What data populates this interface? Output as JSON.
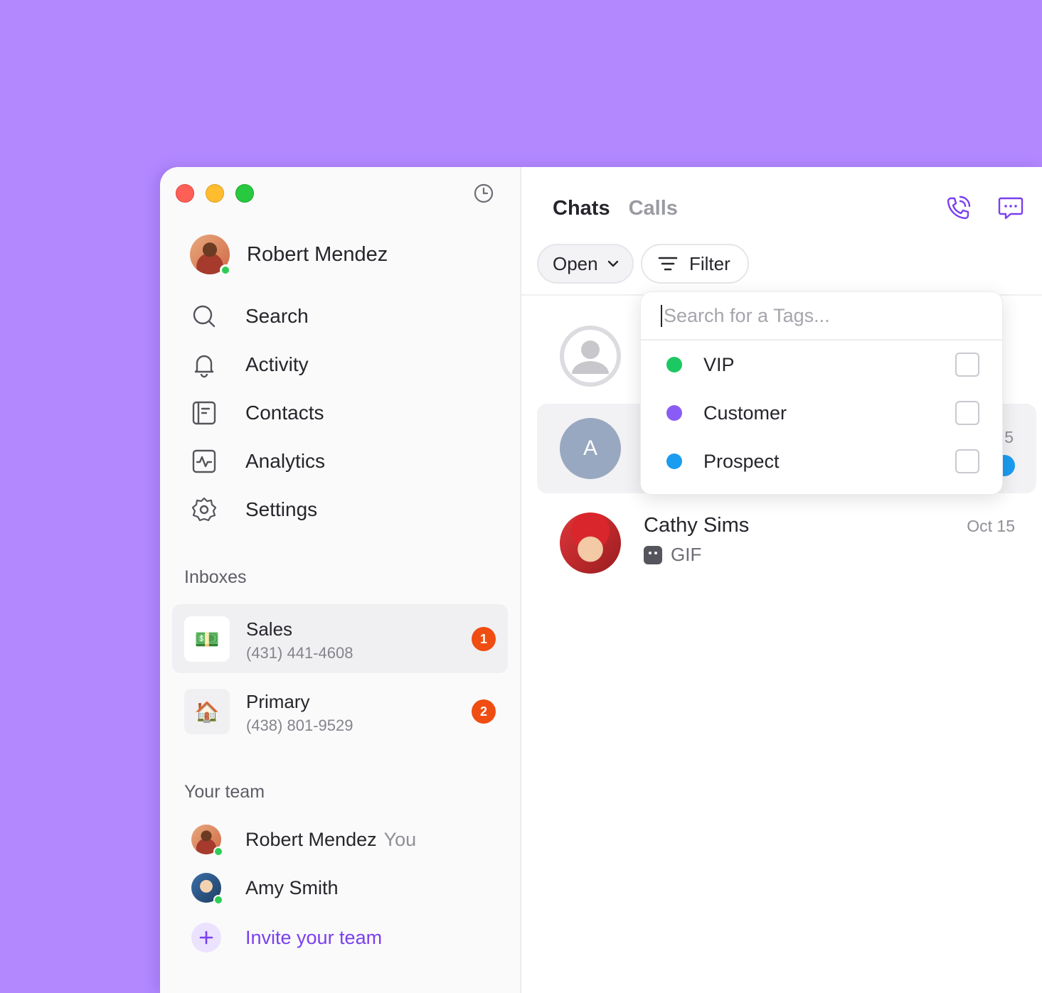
{
  "user": {
    "name": "Robert Mendez"
  },
  "nav": [
    {
      "label": "Search",
      "icon": "search-icon"
    },
    {
      "label": "Activity",
      "icon": "bell-icon"
    },
    {
      "label": "Contacts",
      "icon": "contacts-icon"
    },
    {
      "label": "Analytics",
      "icon": "analytics-icon"
    },
    {
      "label": "Settings",
      "icon": "gear-icon"
    }
  ],
  "inboxes": {
    "title": "Inboxes",
    "items": [
      {
        "name": "Sales",
        "phone": "(431) 441-4608",
        "badge": "1",
        "emoji": "💵"
      },
      {
        "name": "Primary",
        "phone": "(438) 801-9529",
        "badge": "2",
        "emoji": "🏠"
      }
    ]
  },
  "team": {
    "title": "Your team",
    "members": [
      {
        "name": "Robert Mendez",
        "tag": "You"
      },
      {
        "name": "Amy Smith"
      }
    ],
    "invite_label": "Invite your team"
  },
  "main": {
    "tabs": [
      "Chats",
      "Calls"
    ],
    "open_label": "Open",
    "filter_label": "Filter",
    "chats": [
      {
        "avatar_letter": "A",
        "partial_date": "5"
      },
      {
        "name": "Cathy Sims",
        "date": "Oct 15",
        "preview": "GIF"
      }
    ]
  },
  "tag_dropdown": {
    "placeholder": "Search for a Tags...",
    "tags": [
      {
        "label": "VIP",
        "color": "#1cc861"
      },
      {
        "label": "Customer",
        "color": "#8a5cf5"
      },
      {
        "label": "Prospect",
        "color": "#1a9cf0"
      }
    ]
  },
  "colors": {
    "accent": "#7a3ff0",
    "badge": "#f04d12",
    "background": "#b388ff"
  }
}
